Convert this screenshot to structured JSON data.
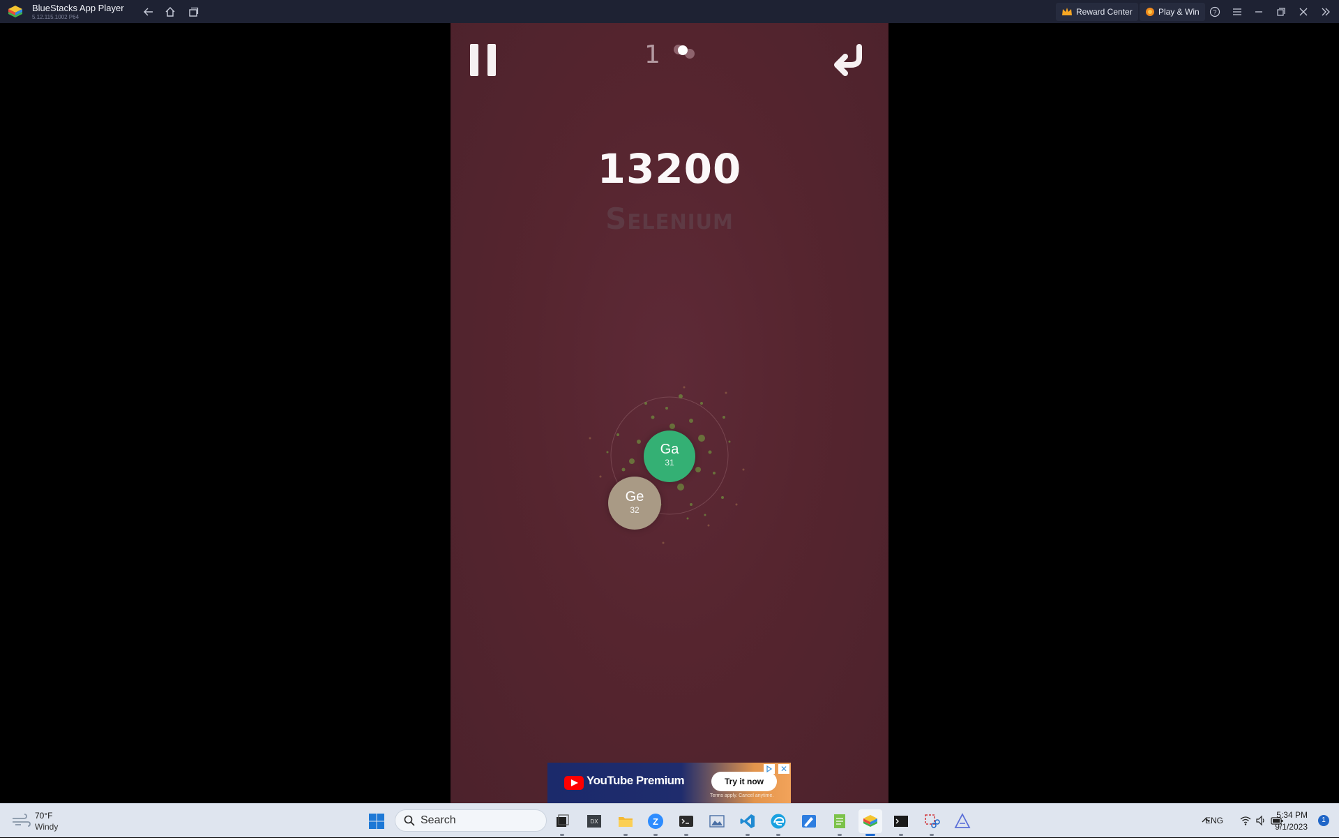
{
  "window": {
    "title": "BlueStacks App Player",
    "version": "5.12.115.1002 P64",
    "reward_center": "Reward Center",
    "play_and_win": "Play & Win"
  },
  "game": {
    "atom_count": "1",
    "score": "13200",
    "element_name": "Selenium",
    "atoms": [
      {
        "symbol": "Ga",
        "number": "31",
        "color": "#34b074"
      },
      {
        "symbol": "Ge",
        "number": "32",
        "color": "#a99a85"
      }
    ]
  },
  "ad": {
    "brand": "YouTube Premium",
    "cta": "Try it now",
    "terms": "Terms apply. Cancel anytime.",
    "close": "✕"
  },
  "taskbar": {
    "weather_temp": "70°F",
    "weather_condition": "Windy",
    "search_placeholder": "Search",
    "language": "ENG",
    "time": "5:34 PM",
    "date": "9/1/2023",
    "notification_count": "1"
  }
}
